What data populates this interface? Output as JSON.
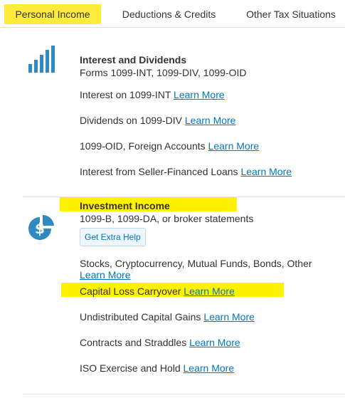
{
  "tabs": [
    {
      "label": "Personal Income",
      "active": true
    },
    {
      "label": "Deductions & Credits",
      "active": false
    },
    {
      "label": "Other Tax Situations",
      "active": false
    }
  ],
  "sections": [
    {
      "icon": "bar-chart-icon",
      "heading": "Interest and Dividends",
      "subheading": "Forms 1099-INT, 1099-DIV, 1099-OID",
      "items": [
        {
          "label": "Interest on 1099-INT",
          "link": "Learn More"
        },
        {
          "label": "Dividends on 1099-DIV",
          "link": "Learn More"
        },
        {
          "label": "1099-OID, Foreign Accounts",
          "link": "Learn More"
        },
        {
          "label": "Interest from Seller-Financed Loans",
          "link": "Learn More"
        }
      ]
    },
    {
      "icon": "dollar-pie-chart-icon",
      "heading": "Investment Income",
      "subheading": "1099-B, 1099-DA, or broker statements",
      "help_button": "Get Extra Help",
      "items": [
        {
          "label": "Stocks, Cryptocurrency, Mutual Funds, Bonds, Other",
          "link": "Learn More"
        },
        {
          "label": "Capital Loss Carryover",
          "link": "Learn More"
        },
        {
          "label": "Undistributed Capital Gains",
          "link": "Learn More"
        },
        {
          "label": "Contracts and Straddles",
          "link": "Learn More"
        },
        {
          "label": "ISO Exercise and Hold",
          "link": "Learn More"
        }
      ]
    }
  ],
  "colors": {
    "highlight": "#fff200",
    "link": "#0077c5",
    "icon": "#2f8bbf",
    "text": "#333333"
  }
}
